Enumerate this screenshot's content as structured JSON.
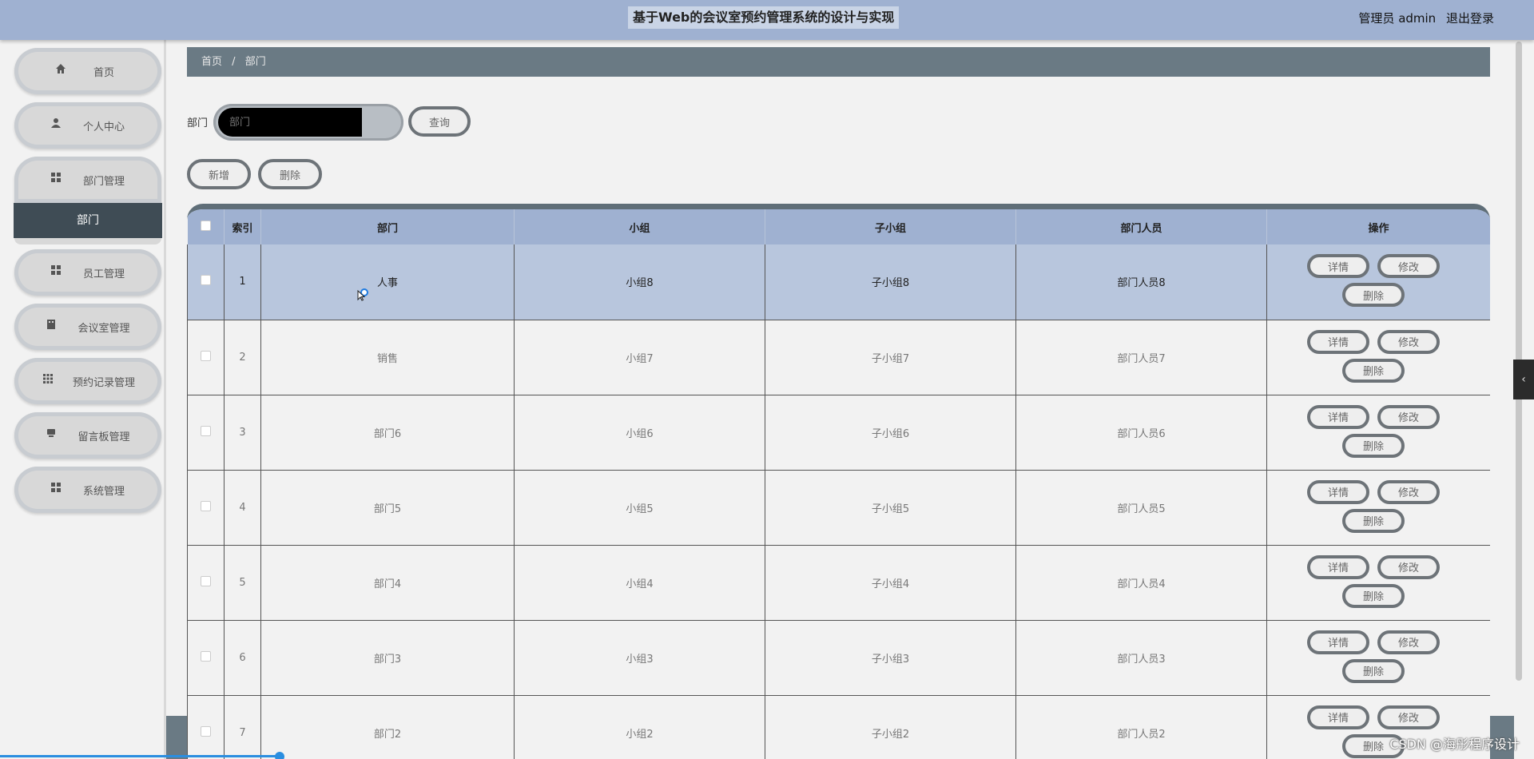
{
  "header": {
    "title": "基于Web的会议室预约管理系统的设计与实现",
    "user_label": "管理员 admin",
    "logout_label": "退出登录"
  },
  "sidebar": {
    "items": [
      {
        "label": "首页",
        "icon": "home-icon"
      },
      {
        "label": "个人中心",
        "icon": "user-icon"
      },
      {
        "label": "部门管理",
        "icon": "grid-icon"
      },
      {
        "label": "员工管理",
        "icon": "grid-icon"
      },
      {
        "label": "会议室管理",
        "icon": "building-icon"
      },
      {
        "label": "预约记录管理",
        "icon": "apps-icon"
      },
      {
        "label": "留言板管理",
        "icon": "message-icon"
      },
      {
        "label": "系统管理",
        "icon": "grid-icon"
      }
    ],
    "submenu": {
      "label": "部门"
    }
  },
  "breadcrumb": {
    "home": "首页",
    "separator": "/",
    "current": "部门"
  },
  "search": {
    "label": "部门",
    "placeholder": "部门",
    "button": "查询"
  },
  "toolbar": {
    "add": "新增",
    "delete": "删除"
  },
  "table": {
    "columns": [
      "索引",
      "部门",
      "小组",
      "子小组",
      "部门人员",
      "操作"
    ],
    "rows": [
      {
        "index": "1",
        "dept": "人事",
        "group": "小组8",
        "subgroup": "子小组8",
        "members": "部门人员8"
      },
      {
        "index": "2",
        "dept": "销售",
        "group": "小组7",
        "subgroup": "子小组7",
        "members": "部门人员7"
      },
      {
        "index": "3",
        "dept": "部门6",
        "group": "小组6",
        "subgroup": "子小组6",
        "members": "部门人员6"
      },
      {
        "index": "4",
        "dept": "部门5",
        "group": "小组5",
        "subgroup": "子小组5",
        "members": "部门人员5"
      },
      {
        "index": "5",
        "dept": "部门4",
        "group": "小组4",
        "subgroup": "子小组4",
        "members": "部门人员4"
      },
      {
        "index": "6",
        "dept": "部门3",
        "group": "小组3",
        "subgroup": "子小组3",
        "members": "部门人员3"
      },
      {
        "index": "7",
        "dept": "部门2",
        "group": "小组2",
        "subgroup": "子小组2",
        "members": "部门人员2"
      }
    ],
    "actions": {
      "detail": "详情",
      "edit": "修改",
      "delete": "删除"
    }
  },
  "watermark": "CSDN @海彤程序设计",
  "colors": {
    "header": "#9fb1d1",
    "breadcrumb": "#6a7a84",
    "submenu": "#3f4c55",
    "selected_row": "#b8c6dd"
  }
}
